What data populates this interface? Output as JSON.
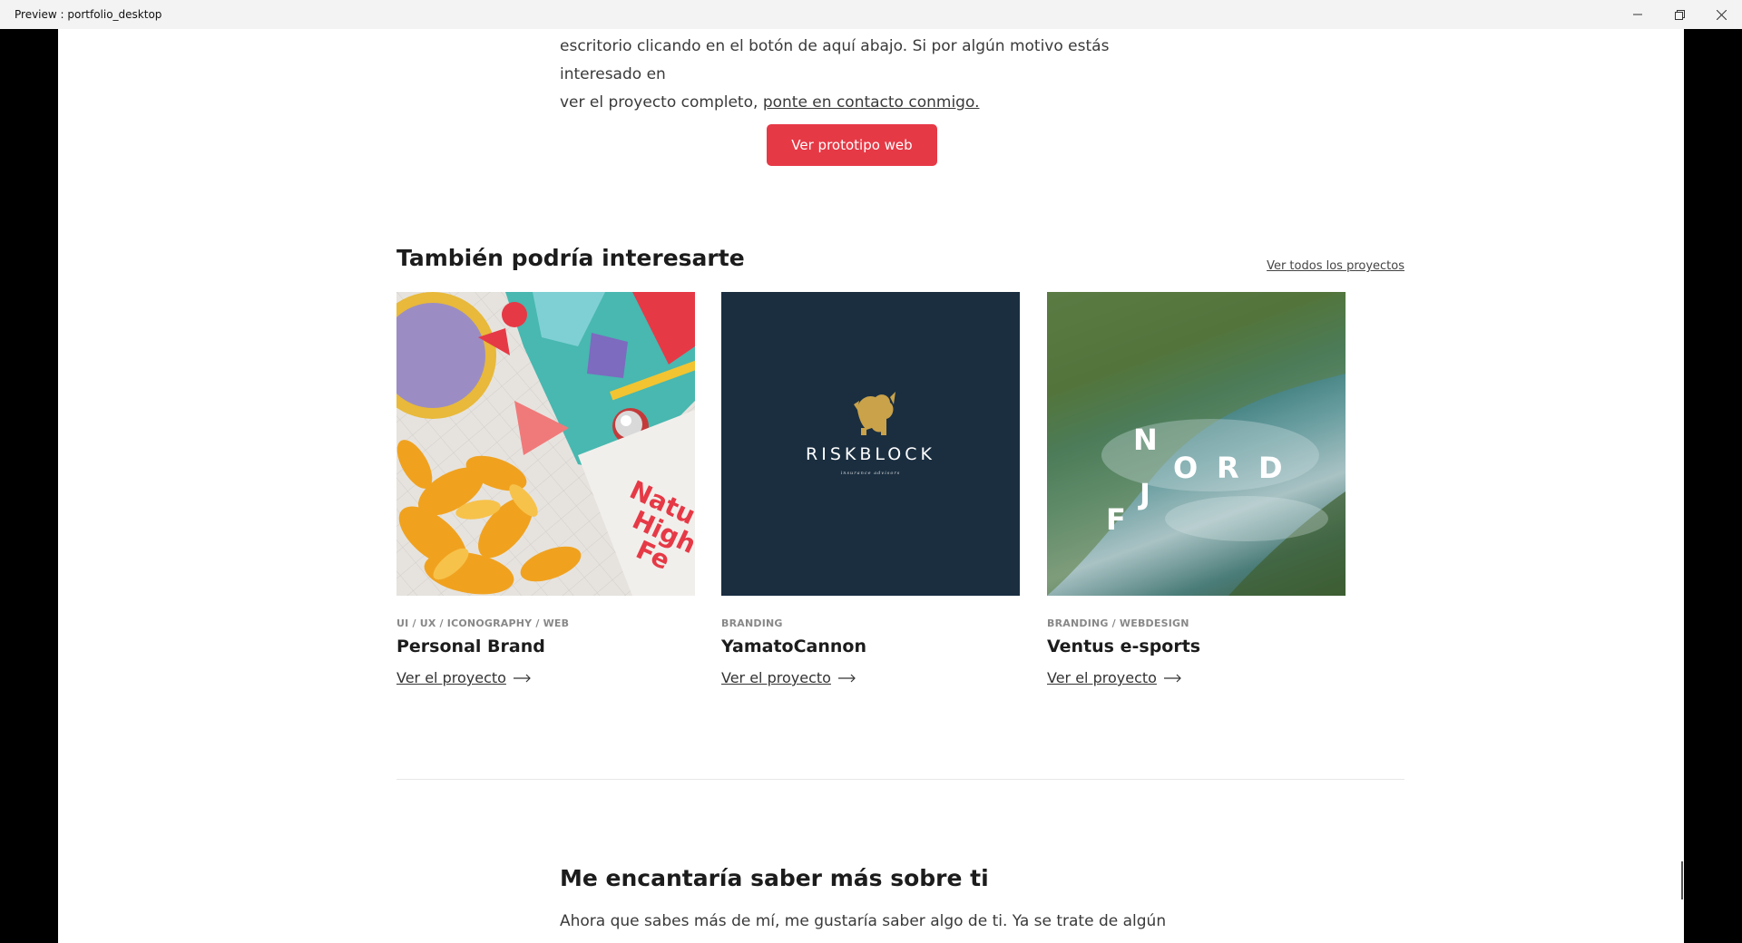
{
  "window": {
    "title": "Preview : portfolio_desktop"
  },
  "intro": {
    "line1": "escritorio clicando en el botón de aquí abajo. Si por algún motivo estás interesado en",
    "line2_prefix": "ver el proyecto completo, ",
    "contact_link": "ponte en contacto conmigo."
  },
  "cta": {
    "label": "Ver prototipo web"
  },
  "related": {
    "title": "También podría interesarte",
    "all_link": "Ver todos los proyectos",
    "cards": [
      {
        "category": "UI / UX / ICONOGRAPHY / WEB",
        "title": "Personal Brand",
        "link": "Ver el proyecto"
      },
      {
        "category": "BRANDING",
        "title": "YamatoCannon",
        "link": "Ver el proyecto",
        "logo_word": "RISKBLOCK",
        "logo_sub": "insurance advisors"
      },
      {
        "category": "BRANDING / WEBDESIGN",
        "title": "Ventus e-sports",
        "link": "Ver el proyecto",
        "logo_letters": [
          "N",
          "O",
          "R",
          "D",
          "J",
          "F"
        ]
      }
    ],
    "card1_art_text": [
      "Natu",
      "High",
      "Fe"
    ]
  },
  "about": {
    "title": "Me encantaría saber más sobre ti",
    "text": "Ahora que sabes más de mí, me gustaría saber algo de ti. Ya se trate de algún proyecto,"
  },
  "colors": {
    "accent": "#e63946",
    "navy": "#1a2e40"
  },
  "icons": {
    "arrow": "arrow-right-icon",
    "minimize": "minimize-icon",
    "restore": "restore-icon",
    "close": "close-icon"
  }
}
